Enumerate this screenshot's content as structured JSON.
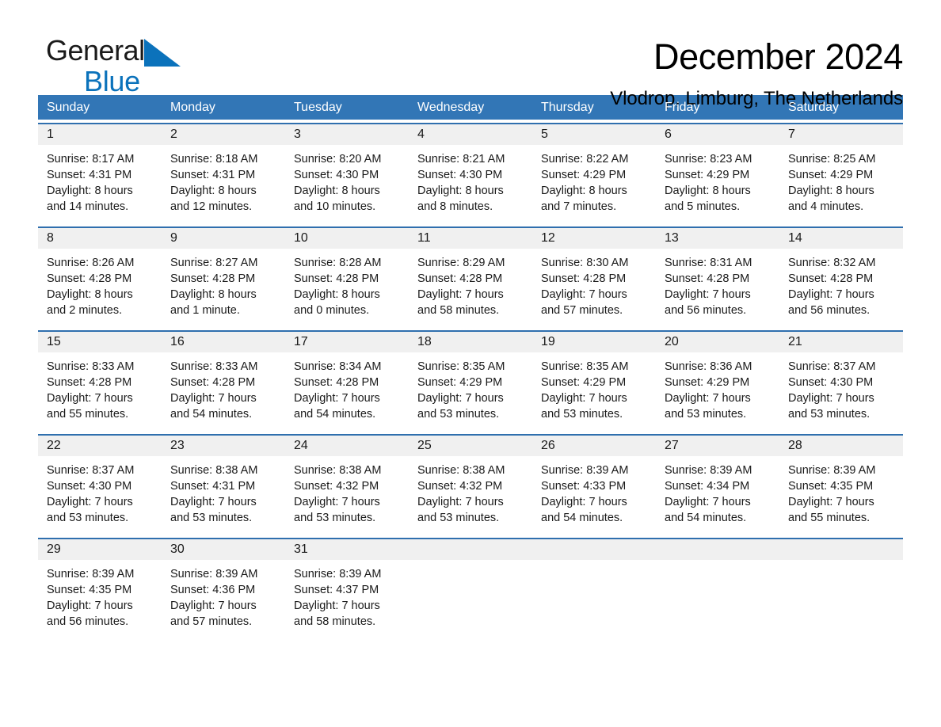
{
  "brand": {
    "name_part1": "General",
    "name_part2": "Blue",
    "triangle_color": "#0b72bb",
    "text_color": "#1a1a1a"
  },
  "header": {
    "month_title": "December 2024",
    "location": "Vlodrop, Limburg, The Netherlands",
    "header_bar_color": "#3276b6",
    "row_divider_color": "#2f6fae",
    "day_number_band_color": "#f0f0f0"
  },
  "weekdays": [
    "Sunday",
    "Monday",
    "Tuesday",
    "Wednesday",
    "Thursday",
    "Friday",
    "Saturday"
  ],
  "weeks": [
    {
      "days": [
        {
          "num": "1",
          "sunrise": "Sunrise: 8:17 AM",
          "sunset": "Sunset: 4:31 PM",
          "daylight1": "Daylight: 8 hours",
          "daylight2": "and 14 minutes."
        },
        {
          "num": "2",
          "sunrise": "Sunrise: 8:18 AM",
          "sunset": "Sunset: 4:31 PM",
          "daylight1": "Daylight: 8 hours",
          "daylight2": "and 12 minutes."
        },
        {
          "num": "3",
          "sunrise": "Sunrise: 8:20 AM",
          "sunset": "Sunset: 4:30 PM",
          "daylight1": "Daylight: 8 hours",
          "daylight2": "and 10 minutes."
        },
        {
          "num": "4",
          "sunrise": "Sunrise: 8:21 AM",
          "sunset": "Sunset: 4:30 PM",
          "daylight1": "Daylight: 8 hours",
          "daylight2": "and 8 minutes."
        },
        {
          "num": "5",
          "sunrise": "Sunrise: 8:22 AM",
          "sunset": "Sunset: 4:29 PM",
          "daylight1": "Daylight: 8 hours",
          "daylight2": "and 7 minutes."
        },
        {
          "num": "6",
          "sunrise": "Sunrise: 8:23 AM",
          "sunset": "Sunset: 4:29 PM",
          "daylight1": "Daylight: 8 hours",
          "daylight2": "and 5 minutes."
        },
        {
          "num": "7",
          "sunrise": "Sunrise: 8:25 AM",
          "sunset": "Sunset: 4:29 PM",
          "daylight1": "Daylight: 8 hours",
          "daylight2": "and 4 minutes."
        }
      ]
    },
    {
      "days": [
        {
          "num": "8",
          "sunrise": "Sunrise: 8:26 AM",
          "sunset": "Sunset: 4:28 PM",
          "daylight1": "Daylight: 8 hours",
          "daylight2": "and 2 minutes."
        },
        {
          "num": "9",
          "sunrise": "Sunrise: 8:27 AM",
          "sunset": "Sunset: 4:28 PM",
          "daylight1": "Daylight: 8 hours",
          "daylight2": "and 1 minute."
        },
        {
          "num": "10",
          "sunrise": "Sunrise: 8:28 AM",
          "sunset": "Sunset: 4:28 PM",
          "daylight1": "Daylight: 8 hours",
          "daylight2": "and 0 minutes."
        },
        {
          "num": "11",
          "sunrise": "Sunrise: 8:29 AM",
          "sunset": "Sunset: 4:28 PM",
          "daylight1": "Daylight: 7 hours",
          "daylight2": "and 58 minutes."
        },
        {
          "num": "12",
          "sunrise": "Sunrise: 8:30 AM",
          "sunset": "Sunset: 4:28 PM",
          "daylight1": "Daylight: 7 hours",
          "daylight2": "and 57 minutes."
        },
        {
          "num": "13",
          "sunrise": "Sunrise: 8:31 AM",
          "sunset": "Sunset: 4:28 PM",
          "daylight1": "Daylight: 7 hours",
          "daylight2": "and 56 minutes."
        },
        {
          "num": "14",
          "sunrise": "Sunrise: 8:32 AM",
          "sunset": "Sunset: 4:28 PM",
          "daylight1": "Daylight: 7 hours",
          "daylight2": "and 56 minutes."
        }
      ]
    },
    {
      "days": [
        {
          "num": "15",
          "sunrise": "Sunrise: 8:33 AM",
          "sunset": "Sunset: 4:28 PM",
          "daylight1": "Daylight: 7 hours",
          "daylight2": "and 55 minutes."
        },
        {
          "num": "16",
          "sunrise": "Sunrise: 8:33 AM",
          "sunset": "Sunset: 4:28 PM",
          "daylight1": "Daylight: 7 hours",
          "daylight2": "and 54 minutes."
        },
        {
          "num": "17",
          "sunrise": "Sunrise: 8:34 AM",
          "sunset": "Sunset: 4:28 PM",
          "daylight1": "Daylight: 7 hours",
          "daylight2": "and 54 minutes."
        },
        {
          "num": "18",
          "sunrise": "Sunrise: 8:35 AM",
          "sunset": "Sunset: 4:29 PM",
          "daylight1": "Daylight: 7 hours",
          "daylight2": "and 53 minutes."
        },
        {
          "num": "19",
          "sunrise": "Sunrise: 8:35 AM",
          "sunset": "Sunset: 4:29 PM",
          "daylight1": "Daylight: 7 hours",
          "daylight2": "and 53 minutes."
        },
        {
          "num": "20",
          "sunrise": "Sunrise: 8:36 AM",
          "sunset": "Sunset: 4:29 PM",
          "daylight1": "Daylight: 7 hours",
          "daylight2": "and 53 minutes."
        },
        {
          "num": "21",
          "sunrise": "Sunrise: 8:37 AM",
          "sunset": "Sunset: 4:30 PM",
          "daylight1": "Daylight: 7 hours",
          "daylight2": "and 53 minutes."
        }
      ]
    },
    {
      "days": [
        {
          "num": "22",
          "sunrise": "Sunrise: 8:37 AM",
          "sunset": "Sunset: 4:30 PM",
          "daylight1": "Daylight: 7 hours",
          "daylight2": "and 53 minutes."
        },
        {
          "num": "23",
          "sunrise": "Sunrise: 8:38 AM",
          "sunset": "Sunset: 4:31 PM",
          "daylight1": "Daylight: 7 hours",
          "daylight2": "and 53 minutes."
        },
        {
          "num": "24",
          "sunrise": "Sunrise: 8:38 AM",
          "sunset": "Sunset: 4:32 PM",
          "daylight1": "Daylight: 7 hours",
          "daylight2": "and 53 minutes."
        },
        {
          "num": "25",
          "sunrise": "Sunrise: 8:38 AM",
          "sunset": "Sunset: 4:32 PM",
          "daylight1": "Daylight: 7 hours",
          "daylight2": "and 53 minutes."
        },
        {
          "num": "26",
          "sunrise": "Sunrise: 8:39 AM",
          "sunset": "Sunset: 4:33 PM",
          "daylight1": "Daylight: 7 hours",
          "daylight2": "and 54 minutes."
        },
        {
          "num": "27",
          "sunrise": "Sunrise: 8:39 AM",
          "sunset": "Sunset: 4:34 PM",
          "daylight1": "Daylight: 7 hours",
          "daylight2": "and 54 minutes."
        },
        {
          "num": "28",
          "sunrise": "Sunrise: 8:39 AM",
          "sunset": "Sunset: 4:35 PM",
          "daylight1": "Daylight: 7 hours",
          "daylight2": "and 55 minutes."
        }
      ]
    },
    {
      "days": [
        {
          "num": "29",
          "sunrise": "Sunrise: 8:39 AM",
          "sunset": "Sunset: 4:35 PM",
          "daylight1": "Daylight: 7 hours",
          "daylight2": "and 56 minutes."
        },
        {
          "num": "30",
          "sunrise": "Sunrise: 8:39 AM",
          "sunset": "Sunset: 4:36 PM",
          "daylight1": "Daylight: 7 hours",
          "daylight2": "and 57 minutes."
        },
        {
          "num": "31",
          "sunrise": "Sunrise: 8:39 AM",
          "sunset": "Sunset: 4:37 PM",
          "daylight1": "Daylight: 7 hours",
          "daylight2": "and 58 minutes."
        },
        {
          "num": "",
          "sunrise": "",
          "sunset": "",
          "daylight1": "",
          "daylight2": ""
        },
        {
          "num": "",
          "sunrise": "",
          "sunset": "",
          "daylight1": "",
          "daylight2": ""
        },
        {
          "num": "",
          "sunrise": "",
          "sunset": "",
          "daylight1": "",
          "daylight2": ""
        },
        {
          "num": "",
          "sunrise": "",
          "sunset": "",
          "daylight1": "",
          "daylight2": ""
        }
      ]
    }
  ]
}
